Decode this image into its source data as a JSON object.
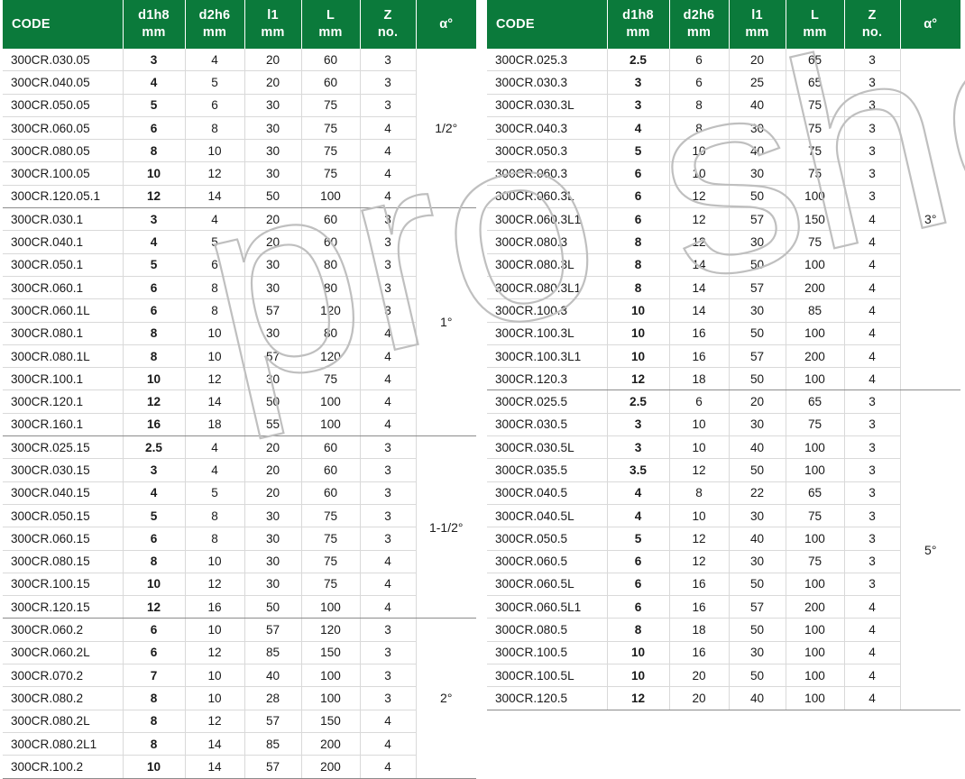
{
  "columns": [
    {
      "symbol": "CODE",
      "unit": ""
    },
    {
      "symbol": "d1h8",
      "unit": "mm"
    },
    {
      "symbol": "d2h6",
      "unit": "mm"
    },
    {
      "symbol": "l1",
      "unit": "mm"
    },
    {
      "symbol": "L",
      "unit": "mm"
    },
    {
      "symbol": "Z",
      "unit": "no."
    },
    {
      "symbol": "α°",
      "unit": ""
    }
  ],
  "colors": {
    "header_green": "#0b7a3b",
    "header_text": "#ffffff",
    "row_line": "#d9d9d9",
    "group_line": "#8c8c8c",
    "body_text": "#1a1a1a",
    "watermark": "#bfbfbf"
  },
  "watermark": {
    "text": "pro shop"
  },
  "tables": [
    {
      "id": "left-table",
      "groups": [
        {
          "alpha": "1/2°",
          "rows": [
            {
              "code": "300CR.030.05",
              "d1h8": "3",
              "d2h6": "4",
              "l1": "20",
              "L": "60",
              "Z": "3"
            },
            {
              "code": "300CR.040.05",
              "d1h8": "4",
              "d2h6": "5",
              "l1": "20",
              "L": "60",
              "Z": "3"
            },
            {
              "code": "300CR.050.05",
              "d1h8": "5",
              "d2h6": "6",
              "l1": "30",
              "L": "75",
              "Z": "3"
            },
            {
              "code": "300CR.060.05",
              "d1h8": "6",
              "d2h6": "8",
              "l1": "30",
              "L": "75",
              "Z": "4"
            },
            {
              "code": "300CR.080.05",
              "d1h8": "8",
              "d2h6": "10",
              "l1": "30",
              "L": "75",
              "Z": "4"
            },
            {
              "code": "300CR.100.05",
              "d1h8": "10",
              "d2h6": "12",
              "l1": "30",
              "L": "75",
              "Z": "4"
            },
            {
              "code": "300CR.120.05.1",
              "d1h8": "12",
              "d2h6": "14",
              "l1": "50",
              "L": "100",
              "Z": "4"
            }
          ]
        },
        {
          "alpha": "1°",
          "rows": [
            {
              "code": "300CR.030.1",
              "d1h8": "3",
              "d2h6": "4",
              "l1": "20",
              "L": "60",
              "Z": "3"
            },
            {
              "code": "300CR.040.1",
              "d1h8": "4",
              "d2h6": "5",
              "l1": "20",
              "L": "60",
              "Z": "3"
            },
            {
              "code": "300CR.050.1",
              "d1h8": "5",
              "d2h6": "6",
              "l1": "30",
              "L": "80",
              "Z": "3"
            },
            {
              "code": "300CR.060.1",
              "d1h8": "6",
              "d2h6": "8",
              "l1": "30",
              "L": "80",
              "Z": "3"
            },
            {
              "code": "300CR.060.1L",
              "d1h8": "6",
              "d2h6": "8",
              "l1": "57",
              "L": "120",
              "Z": "3"
            },
            {
              "code": "300CR.080.1",
              "d1h8": "8",
              "d2h6": "10",
              "l1": "30",
              "L": "80",
              "Z": "4"
            },
            {
              "code": "300CR.080.1L",
              "d1h8": "8",
              "d2h6": "10",
              "l1": "57",
              "L": "120",
              "Z": "4"
            },
            {
              "code": "300CR.100.1",
              "d1h8": "10",
              "d2h6": "12",
              "l1": "30",
              "L": "75",
              "Z": "4"
            },
            {
              "code": "300CR.120.1",
              "d1h8": "12",
              "d2h6": "14",
              "l1": "50",
              "L": "100",
              "Z": "4"
            },
            {
              "code": "300CR.160.1",
              "d1h8": "16",
              "d2h6": "18",
              "l1": "55",
              "L": "100",
              "Z": "4"
            }
          ]
        },
        {
          "alpha": "1-1/2°",
          "rows": [
            {
              "code": "300CR.025.15",
              "d1h8": "2.5",
              "d2h6": "4",
              "l1": "20",
              "L": "60",
              "Z": "3"
            },
            {
              "code": "300CR.030.15",
              "d1h8": "3",
              "d2h6": "4",
              "l1": "20",
              "L": "60",
              "Z": "3"
            },
            {
              "code": "300CR.040.15",
              "d1h8": "4",
              "d2h6": "5",
              "l1": "20",
              "L": "60",
              "Z": "3"
            },
            {
              "code": "300CR.050.15",
              "d1h8": "5",
              "d2h6": "8",
              "l1": "30",
              "L": "75",
              "Z": "3"
            },
            {
              "code": "300CR.060.15",
              "d1h8": "6",
              "d2h6": "8",
              "l1": "30",
              "L": "75",
              "Z": "3"
            },
            {
              "code": "300CR.080.15",
              "d1h8": "8",
              "d2h6": "10",
              "l1": "30",
              "L": "75",
              "Z": "4"
            },
            {
              "code": "300CR.100.15",
              "d1h8": "10",
              "d2h6": "12",
              "l1": "30",
              "L": "75",
              "Z": "4"
            },
            {
              "code": "300CR.120.15",
              "d1h8": "12",
              "d2h6": "16",
              "l1": "50",
              "L": "100",
              "Z": "4"
            }
          ]
        },
        {
          "alpha": "2°",
          "rows": [
            {
              "code": "300CR.060.2",
              "d1h8": "6",
              "d2h6": "10",
              "l1": "57",
              "L": "120",
              "Z": "3"
            },
            {
              "code": "300CR.060.2L",
              "d1h8": "6",
              "d2h6": "12",
              "l1": "85",
              "L": "150",
              "Z": "3"
            },
            {
              "code": "300CR.070.2",
              "d1h8": "7",
              "d2h6": "10",
              "l1": "40",
              "L": "100",
              "Z": "3"
            },
            {
              "code": "300CR.080.2",
              "d1h8": "8",
              "d2h6": "10",
              "l1": "28",
              "L": "100",
              "Z": "3"
            },
            {
              "code": "300CR.080.2L",
              "d1h8": "8",
              "d2h6": "12",
              "l1": "57",
              "L": "150",
              "Z": "4"
            },
            {
              "code": "300CR.080.2L1",
              "d1h8": "8",
              "d2h6": "14",
              "l1": "85",
              "L": "200",
              "Z": "4"
            },
            {
              "code": "300CR.100.2",
              "d1h8": "10",
              "d2h6": "14",
              "l1": "57",
              "L": "200",
              "Z": "4"
            }
          ]
        }
      ]
    },
    {
      "id": "right-table",
      "groups": [
        {
          "alpha": "3°",
          "rows": [
            {
              "code": "300CR.025.3",
              "d1h8": "2.5",
              "d2h6": "6",
              "l1": "20",
              "L": "65",
              "Z": "3"
            },
            {
              "code": "300CR.030.3",
              "d1h8": "3",
              "d2h6": "6",
              "l1": "25",
              "L": "65",
              "Z": "3"
            },
            {
              "code": "300CR.030.3L",
              "d1h8": "3",
              "d2h6": "8",
              "l1": "40",
              "L": "75",
              "Z": "3"
            },
            {
              "code": "300CR.040.3",
              "d1h8": "4",
              "d2h6": "8",
              "l1": "30",
              "L": "75",
              "Z": "3"
            },
            {
              "code": "300CR.050.3",
              "d1h8": "5",
              "d2h6": "10",
              "l1": "40",
              "L": "75",
              "Z": "3"
            },
            {
              "code": "300CR.060.3",
              "d1h8": "6",
              "d2h6": "10",
              "l1": "30",
              "L": "75",
              "Z": "3"
            },
            {
              "code": "300CR.060.3L",
              "d1h8": "6",
              "d2h6": "12",
              "l1": "50",
              "L": "100",
              "Z": "3"
            },
            {
              "code": "300CR.060.3L1",
              "d1h8": "6",
              "d2h6": "12",
              "l1": "57",
              "L": "150",
              "Z": "4"
            },
            {
              "code": "300CR.080.3",
              "d1h8": "8",
              "d2h6": "12",
              "l1": "30",
              "L": "75",
              "Z": "4"
            },
            {
              "code": "300CR.080.3L",
              "d1h8": "8",
              "d2h6": "14",
              "l1": "50",
              "L": "100",
              "Z": "4"
            },
            {
              "code": "300CR.080.3L1",
              "d1h8": "8",
              "d2h6": "14",
              "l1": "57",
              "L": "200",
              "Z": "4"
            },
            {
              "code": "300CR.100.3",
              "d1h8": "10",
              "d2h6": "14",
              "l1": "30",
              "L": "85",
              "Z": "4"
            },
            {
              "code": "300CR.100.3L",
              "d1h8": "10",
              "d2h6": "16",
              "l1": "50",
              "L": "100",
              "Z": "4"
            },
            {
              "code": "300CR.100.3L1",
              "d1h8": "10",
              "d2h6": "16",
              "l1": "57",
              "L": "200",
              "Z": "4"
            },
            {
              "code": "300CR.120.3",
              "d1h8": "12",
              "d2h6": "18",
              "l1": "50",
              "L": "100",
              "Z": "4"
            }
          ]
        },
        {
          "alpha": "5°",
          "rows": [
            {
              "code": "300CR.025.5",
              "d1h8": "2.5",
              "d2h6": "6",
              "l1": "20",
              "L": "65",
              "Z": "3"
            },
            {
              "code": "300CR.030.5",
              "d1h8": "3",
              "d2h6": "10",
              "l1": "30",
              "L": "75",
              "Z": "3"
            },
            {
              "code": "300CR.030.5L",
              "d1h8": "3",
              "d2h6": "10",
              "l1": "40",
              "L": "100",
              "Z": "3"
            },
            {
              "code": "300CR.035.5",
              "d1h8": "3.5",
              "d2h6": "12",
              "l1": "50",
              "L": "100",
              "Z": "3"
            },
            {
              "code": "300CR.040.5",
              "d1h8": "4",
              "d2h6": "8",
              "l1": "22",
              "L": "65",
              "Z": "3"
            },
            {
              "code": "300CR.040.5L",
              "d1h8": "4",
              "d2h6": "10",
              "l1": "30",
              "L": "75",
              "Z": "3"
            },
            {
              "code": "300CR.050.5",
              "d1h8": "5",
              "d2h6": "12",
              "l1": "40",
              "L": "100",
              "Z": "3"
            },
            {
              "code": "300CR.060.5",
              "d1h8": "6",
              "d2h6": "12",
              "l1": "30",
              "L": "75",
              "Z": "3"
            },
            {
              "code": "300CR.060.5L",
              "d1h8": "6",
              "d2h6": "16",
              "l1": "50",
              "L": "100",
              "Z": "3"
            },
            {
              "code": "300CR.060.5L1",
              "d1h8": "6",
              "d2h6": "16",
              "l1": "57",
              "L": "200",
              "Z": "4"
            },
            {
              "code": "300CR.080.5",
              "d1h8": "8",
              "d2h6": "18",
              "l1": "50",
              "L": "100",
              "Z": "4"
            },
            {
              "code": "300CR.100.5",
              "d1h8": "10",
              "d2h6": "16",
              "l1": "30",
              "L": "100",
              "Z": "4"
            },
            {
              "code": "300CR.100.5L",
              "d1h8": "10",
              "d2h6": "20",
              "l1": "50",
              "L": "100",
              "Z": "4"
            },
            {
              "code": "300CR.120.5",
              "d1h8": "12",
              "d2h6": "20",
              "l1": "40",
              "L": "100",
              "Z": "4"
            }
          ]
        }
      ]
    }
  ]
}
